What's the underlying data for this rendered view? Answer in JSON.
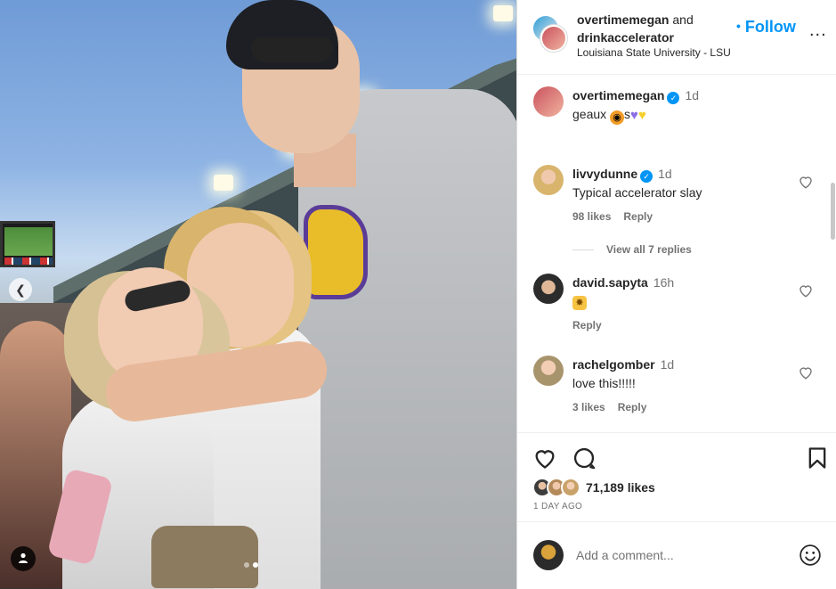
{
  "post_header": {
    "user1": "overtimemegan",
    "joiner": "and",
    "user2": "drinkaccelerator",
    "location": "Louisiana State University - LSU",
    "follow_label": "Follow",
    "dot": "•",
    "more_label": "..."
  },
  "comments": [
    {
      "user": "overtimemegan",
      "verified": true,
      "time": "1d",
      "text_parts": [
        "geaux ",
        "s",
        ""
      ],
      "emoji_hearts": [
        "#8c6fe6",
        "#f5cf2a"
      ]
    },
    {
      "user": "livvydunne",
      "verified": true,
      "time": "1d",
      "text": "Typical accelerator slay",
      "likes": "98 likes",
      "reply": "Reply",
      "view_replies": "View all 7 replies"
    },
    {
      "user": "david.sapyta",
      "verified": false,
      "time": "16h",
      "reply": "Reply"
    },
    {
      "user": "rachelgomber",
      "verified": false,
      "time": "1d",
      "text": "love this!!!!!",
      "likes": "3 likes",
      "reply": "Reply"
    }
  ],
  "actions": {
    "likes_count": "71,189 likes",
    "date": "1 DAY AGO"
  },
  "add_comment": {
    "placeholder": "Add a comment..."
  },
  "icons": {
    "heart": "heart-icon",
    "comment": "comment-icon",
    "bookmark": "bookmark-icon",
    "emoji": "emoji-icon",
    "verified": "verified-icon",
    "carousel_prev": "chevron-left-icon",
    "tag": "user-tag-icon"
  },
  "colors": {
    "accent": "#0095f6",
    "text": "#262626",
    "muted": "#737373",
    "border": "#dbdbdb"
  }
}
